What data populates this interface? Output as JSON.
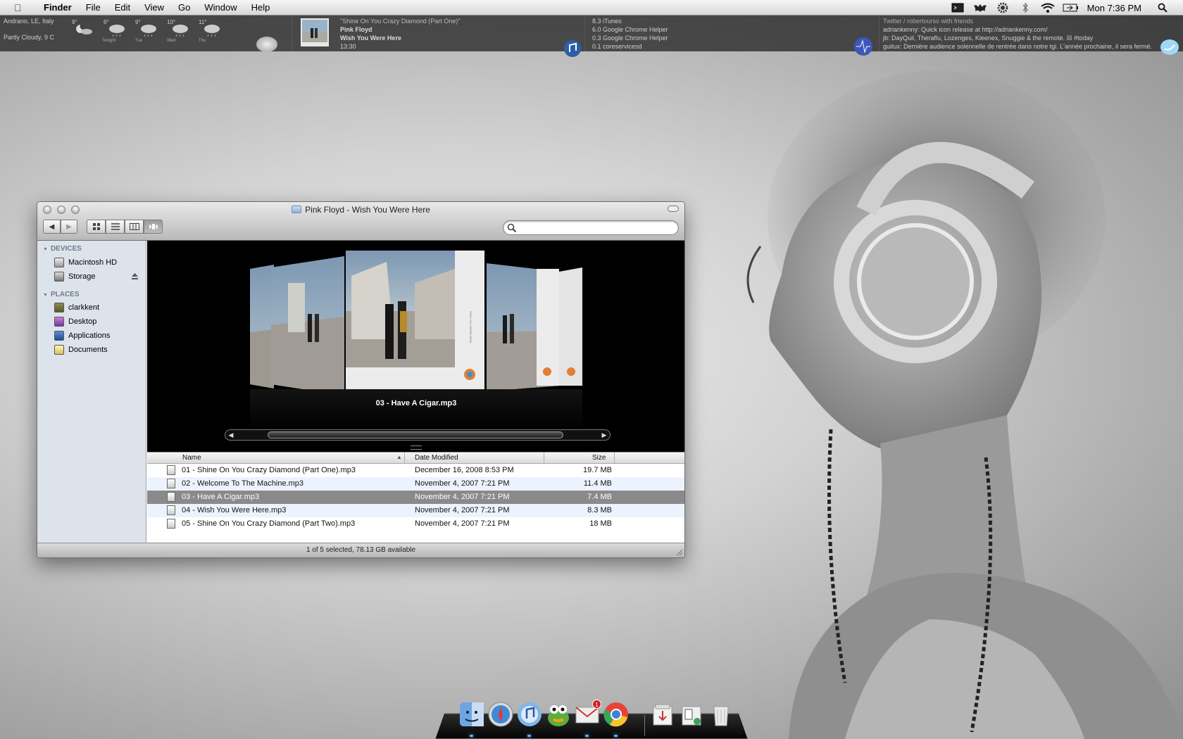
{
  "menubar": {
    "app_name": "Finder",
    "items": [
      "File",
      "Edit",
      "View",
      "Go",
      "Window",
      "Help"
    ],
    "clock": "Mon 7:36 PM",
    "extras": [
      "terminal-icon",
      "bat-icon",
      "gear-icon",
      "bluetooth-icon",
      "wifi-icon",
      "battery-icon",
      "spotlight-icon"
    ]
  },
  "weather": {
    "location": "Andrano, LE, Italy",
    "condition": "Partly Cloudy, 9 C",
    "forecast": [
      {
        "temp": "9°",
        "label": ""
      },
      {
        "temp": "6°",
        "label": "Tonight"
      },
      {
        "temp": "9°",
        "label": "Tue"
      },
      {
        "temp": "10°",
        "label": "Wed"
      },
      {
        "temp": "11°",
        "label": "Thu"
      }
    ]
  },
  "now_playing": {
    "song": "\"Shine On You Crazy Diamond (Part One)\"",
    "artist": "Pink Floyd",
    "album": "Wish You Were Here",
    "time": "13:30"
  },
  "processes": {
    "lines": [
      "8.3 iTunes",
      "6.0 Google Chrome Helper",
      "0.3 Google Chrome Helper",
      "0.1 coreservicesd"
    ]
  },
  "twitter": {
    "header": "Twitter / robertourso with friends",
    "lines": [
      "adriankenny: Quick icon release at http://adriankenny.com/",
      "jb: DayQuil, Theraflu, Lozenges, Kleenex, Snuggie & the remote. ☒ #today",
      "guitux: Dernière audience solennelle de rentrée dans notre tgi. L'année prochaine, il sera fermé."
    ]
  },
  "finder": {
    "title": "Pink Floyd - Wish You Were Here",
    "search": {
      "placeholder": "",
      "value": ""
    },
    "sidebar": {
      "devices_label": "DEVICES",
      "devices": [
        "Macintosh HD",
        "Storage"
      ],
      "places_label": "PLACES",
      "places": [
        "clarkkent",
        "Desktop",
        "Applications",
        "Documents"
      ]
    },
    "coverflow_caption": "03 - Have A Cigar.mp3",
    "columns": {
      "name": "Name",
      "date": "Date Modified",
      "size": "Size"
    },
    "rows": [
      {
        "name": "01 - Shine On You Crazy Diamond (Part One).mp3",
        "date": "December 16, 2008 8:53 PM",
        "size": "19.7 MB"
      },
      {
        "name": "02 - Welcome To The Machine.mp3",
        "date": "November 4, 2007 7:21 PM",
        "size": "11.4 MB"
      },
      {
        "name": "03 - Have A Cigar.mp3",
        "date": "November 4, 2007 7:21 PM",
        "size": "7.4 MB"
      },
      {
        "name": "04 - Wish You Were Here.mp3",
        "date": "November 4, 2007 7:21 PM",
        "size": "8.3 MB"
      },
      {
        "name": "05 - Shine On You Crazy Diamond (Part Two).mp3",
        "date": "November 4, 2007 7:21 PM",
        "size": "18 MB"
      }
    ],
    "selected_row": 3,
    "status": "1 of 5 selected, 78.13 GB available"
  },
  "dock": {
    "apps": [
      "finder-icon",
      "safari-icon",
      "itunes-icon",
      "adium-icon",
      "mail-icon",
      "chrome-icon",
      "downloads-stack-icon",
      "documents-stack-icon",
      "trash-icon"
    ],
    "mail_badge": "1"
  },
  "colors": {
    "menubar_bg": "#e0e0e0",
    "sidebar_bg": "#dde3ea",
    "selected_row": "#8a8a8a",
    "alt_row": "#edf3fe",
    "dock_indicator": "#5fb4ff"
  }
}
